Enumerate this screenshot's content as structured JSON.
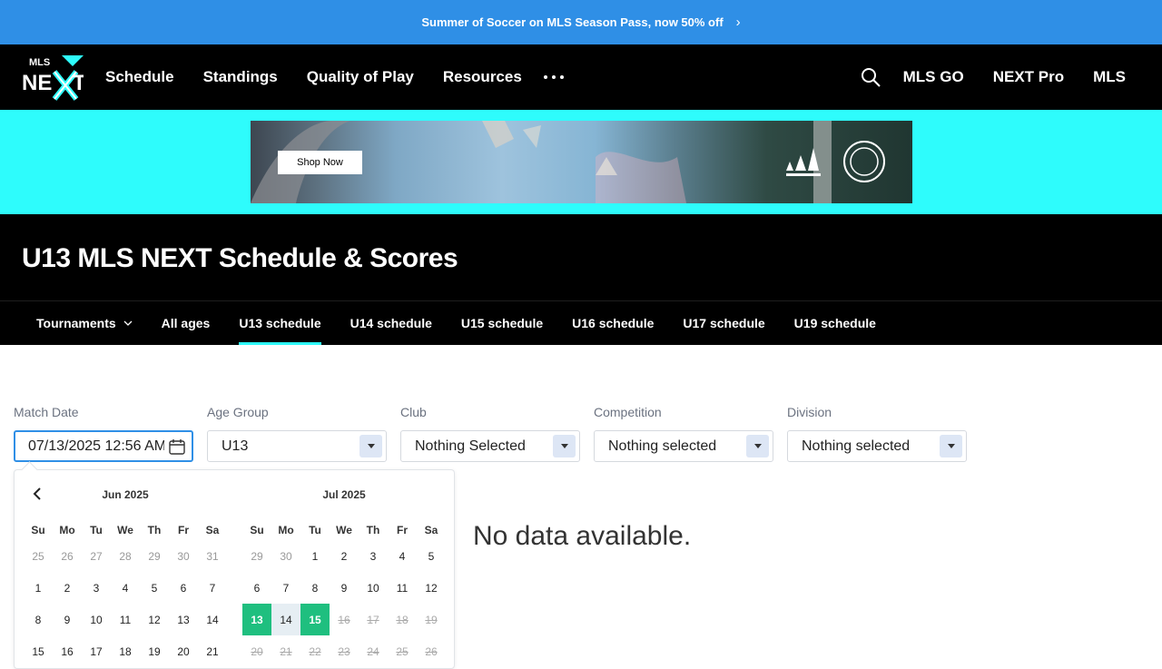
{
  "promo": {
    "text": "Summer of Soccer on MLS Season Pass, now 50% off",
    "chevron": "›"
  },
  "nav": {
    "links": [
      "Schedule",
      "Standings",
      "Quality of Play",
      "Resources"
    ],
    "right": [
      "MLS GO",
      "NEXT Pro",
      "MLS"
    ],
    "logo_text": "MLS NEXT",
    "accent": "#2efcfc"
  },
  "ad": {
    "button": "Shop Now"
  },
  "page": {
    "title": "U13 MLS NEXT Schedule & Scores"
  },
  "tabs": [
    "Tournaments",
    "All ages",
    "U13 schedule",
    "U14 schedule",
    "U15 schedule",
    "U16 schedule",
    "U17 schedule",
    "U19 schedule"
  ],
  "filters": {
    "date_label": "Match Date",
    "date_value": "07/13/2025 12:56 AM",
    "age_label": "Age Group",
    "age_value": "U13",
    "club_label": "Club",
    "club_value": "Nothing Selected",
    "comp_label": "Competition",
    "comp_value": "Nothing selected",
    "div_label": "Division",
    "div_value": "Nothing selected"
  },
  "calendar": {
    "dow": [
      "Su",
      "Mo",
      "Tu",
      "We",
      "Th",
      "Fr",
      "Sa"
    ],
    "months": [
      {
        "title": "Jun 2025",
        "days": [
          [
            "25",
            "other"
          ],
          [
            "26",
            "other"
          ],
          [
            "27",
            "other"
          ],
          [
            "28",
            "other"
          ],
          [
            "29",
            "other"
          ],
          [
            "30",
            "other"
          ],
          [
            "31",
            "other"
          ],
          [
            "1",
            ""
          ],
          [
            "2",
            ""
          ],
          [
            "3",
            ""
          ],
          [
            "4",
            ""
          ],
          [
            "5",
            ""
          ],
          [
            "6",
            ""
          ],
          [
            "7",
            ""
          ],
          [
            "8",
            ""
          ],
          [
            "9",
            ""
          ],
          [
            "10",
            ""
          ],
          [
            "11",
            ""
          ],
          [
            "12",
            ""
          ],
          [
            "13",
            ""
          ],
          [
            "14",
            ""
          ],
          [
            "15",
            ""
          ],
          [
            "16",
            ""
          ],
          [
            "17",
            ""
          ],
          [
            "18",
            ""
          ],
          [
            "19",
            ""
          ],
          [
            "20",
            ""
          ],
          [
            "21",
            ""
          ]
        ]
      },
      {
        "title": "Jul 2025",
        "days": [
          [
            "29",
            "other"
          ],
          [
            "30",
            "other"
          ],
          [
            "1",
            ""
          ],
          [
            "2",
            ""
          ],
          [
            "3",
            ""
          ],
          [
            "4",
            ""
          ],
          [
            "5",
            ""
          ],
          [
            "6",
            ""
          ],
          [
            "7",
            ""
          ],
          [
            "8",
            ""
          ],
          [
            "9",
            ""
          ],
          [
            "10",
            ""
          ],
          [
            "11",
            ""
          ],
          [
            "12",
            ""
          ],
          [
            "13",
            "sel"
          ],
          [
            "14",
            "range"
          ],
          [
            "15",
            "sel"
          ],
          [
            "16",
            "disabled"
          ],
          [
            "17",
            "disabled"
          ],
          [
            "18",
            "disabled"
          ],
          [
            "19",
            "disabled"
          ],
          [
            "20",
            "disabled"
          ],
          [
            "21",
            "disabled"
          ],
          [
            "22",
            "disabled"
          ],
          [
            "23",
            "disabled"
          ],
          [
            "24",
            "disabled"
          ],
          [
            "25",
            "disabled"
          ],
          [
            "26",
            "disabled"
          ]
        ]
      }
    ]
  },
  "results": {
    "empty": "No data available."
  },
  "colors": {
    "promo": "#2f8fe6",
    "selected": "#1fbf7f",
    "focus": "#2f8fe6"
  }
}
